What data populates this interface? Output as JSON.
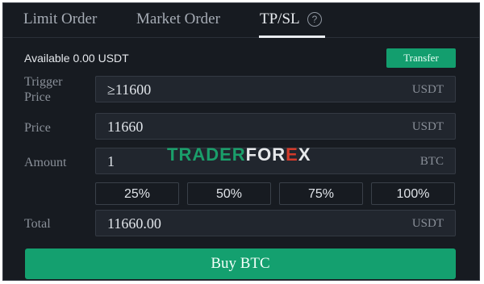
{
  "tabs": [
    {
      "label": "Limit Order"
    },
    {
      "label": "Market Order"
    },
    {
      "label": "TP/SL"
    }
  ],
  "active_tab": "TP/SL",
  "icons": {
    "help": "help-circle-icon"
  },
  "available": "Available 0.00 USDT",
  "transfer_label": "Transfer",
  "form": {
    "trigger": {
      "label_line1": "Trigger",
      "label_line2": "Price",
      "value": "≥11600",
      "unit": "USDT"
    },
    "price": {
      "label": "Price",
      "value": "11660",
      "unit": "USDT"
    },
    "amount": {
      "label": "Amount",
      "value": "1",
      "unit": "BTC"
    },
    "total": {
      "label": "Total",
      "value": "11660.00",
      "unit": "USDT"
    }
  },
  "percent_buttons": [
    "25%",
    "50%",
    "75%",
    "100%"
  ],
  "buy_label": "Buy BTC",
  "watermark": {
    "part1": "TRADER",
    "part2": "FOR",
    "part3": "E",
    "part4": "X"
  },
  "colors": {
    "accent": "#14a06f",
    "panel_bg": "#171b21",
    "field_bg": "#21262e"
  }
}
